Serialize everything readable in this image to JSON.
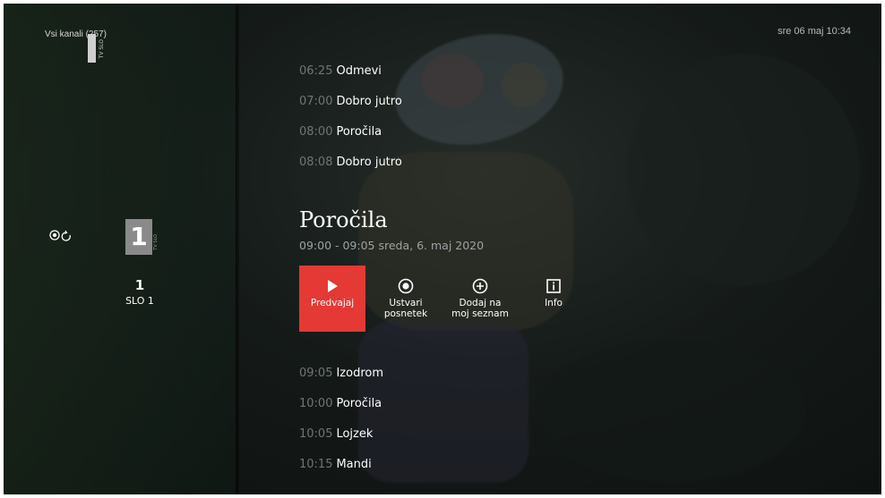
{
  "header": {
    "channels_filter": "Vsi kanali (257)",
    "clock": "sre 06 maj  10:34"
  },
  "channel": {
    "number": "1",
    "name": "SLO 1",
    "logo_digit": "1",
    "logo_badge": "TV SLO"
  },
  "programs_before": [
    {
      "time": "06:25",
      "title": "Odmevi"
    },
    {
      "time": "07:00",
      "title": "Dobro jutro"
    },
    {
      "time": "08:00",
      "title": "Poročila"
    },
    {
      "time": "08:08",
      "title": "Dobro jutro"
    }
  ],
  "selected": {
    "title": "Poročila",
    "subtitle": "09:00 - 09:05 sreda, 6. maj 2020"
  },
  "actions": [
    {
      "label1": "Predvajaj",
      "label2": "",
      "icon": "play-icon"
    },
    {
      "label1": "Ustvari",
      "label2": "posnetek",
      "icon": "record-icon"
    },
    {
      "label1": "Dodaj na",
      "label2": "moj seznam",
      "icon": "add-circle-icon"
    },
    {
      "label1": "Info",
      "label2": "",
      "icon": "info-icon"
    }
  ],
  "programs_after": [
    {
      "time": "09:05",
      "title": "Izodrom"
    },
    {
      "time": "10:00",
      "title": "Poročila"
    },
    {
      "time": "10:05",
      "title": "Lojzek"
    },
    {
      "time": "10:15",
      "title": "Mandi"
    }
  ],
  "colors": {
    "accent": "#e53935",
    "time_muted": "#6f7676"
  }
}
